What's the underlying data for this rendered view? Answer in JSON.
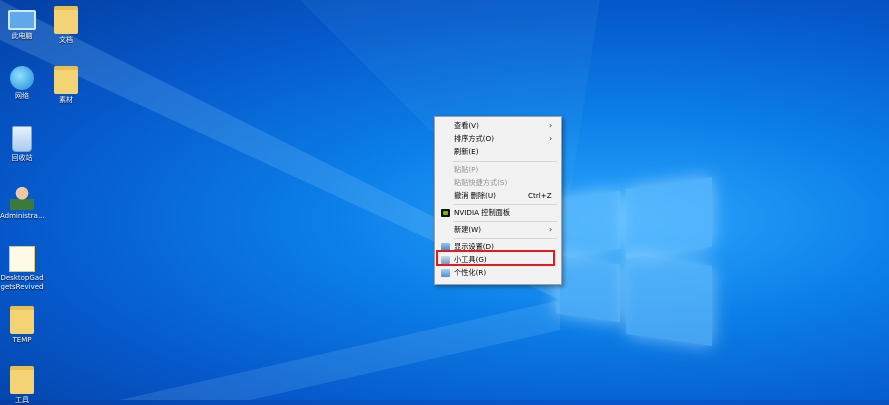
{
  "desktop": {
    "icons": [
      {
        "label_line1": "此电脑",
        "label_line2": "",
        "icon": "computer-icon"
      },
      {
        "label_line1": "文档",
        "label_line2": "",
        "icon": "documents-folder-icon"
      },
      {
        "label_line1": "网络",
        "label_line2": "",
        "icon": "network-icon"
      },
      {
        "label_line1": "素材",
        "label_line2": "",
        "icon": "materials-folder-icon"
      },
      {
        "label_line1": "回收站",
        "label_line2": "",
        "icon": "recycle-bin-icon"
      },
      {
        "label_line1": "Administra...",
        "label_line2": "",
        "icon": "user-folder-icon"
      },
      {
        "label_line1": "DesktopGad",
        "label_line2": "getsRevived",
        "icon": "file-icon"
      },
      {
        "label_line1": "TEMP",
        "label_line2": "",
        "icon": "temp-folder-icon"
      },
      {
        "label_line1": "工具",
        "label_line2": "",
        "icon": "tools-folder-icon"
      }
    ]
  },
  "context_menu": {
    "view": "查看(V)",
    "sort_by": "排序方式(O)",
    "refresh": "刷新(E)",
    "paste": "粘贴(P)",
    "paste_shortcut": "粘贴快捷方式(S)",
    "undo_delete": "撤消 删除(U)",
    "undo_shortcut": "Ctrl+Z",
    "nvidia": "NVIDIA 控制面板",
    "new": "新建(W)",
    "display_settings": "显示设置(D)",
    "gadgets": "小工具(G)",
    "personalize": "个性化(R)",
    "submenu_arrow": "›"
  },
  "colors": {
    "highlight_box": "#e21c1c",
    "desktop_accent": "#0b7de6"
  }
}
